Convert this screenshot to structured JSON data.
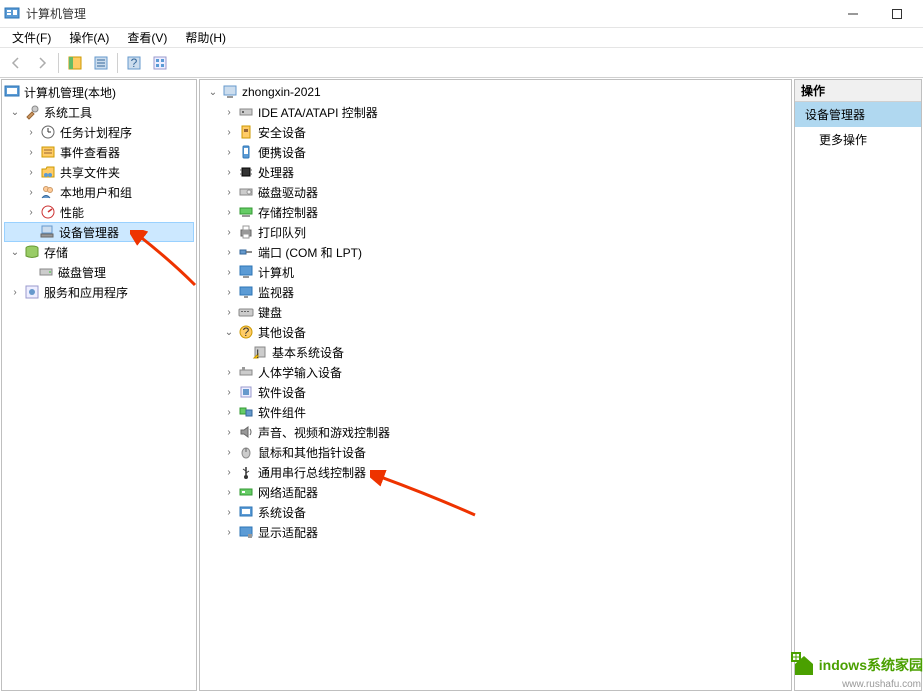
{
  "titlebar": {
    "title": "计算机管理"
  },
  "menubar": {
    "file": "文件(F)",
    "action": "操作(A)",
    "view": "查看(V)",
    "help": "帮助(H)"
  },
  "left_tree": {
    "root": "计算机管理(本地)",
    "system_tools": "系统工具",
    "task_scheduler": "任务计划程序",
    "event_viewer": "事件查看器",
    "shared_folders": "共享文件夹",
    "local_users": "本地用户和组",
    "performance": "性能",
    "device_manager": "设备管理器",
    "storage": "存储",
    "disk_management": "磁盘管理",
    "services": "服务和应用程序"
  },
  "center_tree": {
    "root": "zhongxin-2021",
    "ide": "IDE ATA/ATAPI 控制器",
    "security": "安全设备",
    "portable": "便携设备",
    "processors": "处理器",
    "disk_drives": "磁盘驱动器",
    "storage_ctrl": "存储控制器",
    "print_queue": "打印队列",
    "ports": "端口 (COM 和 LPT)",
    "computer": "计算机",
    "monitor": "监视器",
    "keyboard": "键盘",
    "other": "其他设备",
    "other_base": "基本系统设备",
    "hid": "人体学输入设备",
    "software_dev": "软件设备",
    "software_comp": "软件组件",
    "sound": "声音、视频和游戏控制器",
    "mouse": "鼠标和其他指针设备",
    "usb": "通用串行总线控制器",
    "network": "网络适配器",
    "system_dev": "系统设备",
    "display": "显示适配器"
  },
  "right_pane": {
    "header": "操作",
    "device_mgr": "设备管理器",
    "more": "更多操作"
  },
  "watermark": {
    "text": "indows系统家园",
    "sub": "www.rushafu.com"
  }
}
